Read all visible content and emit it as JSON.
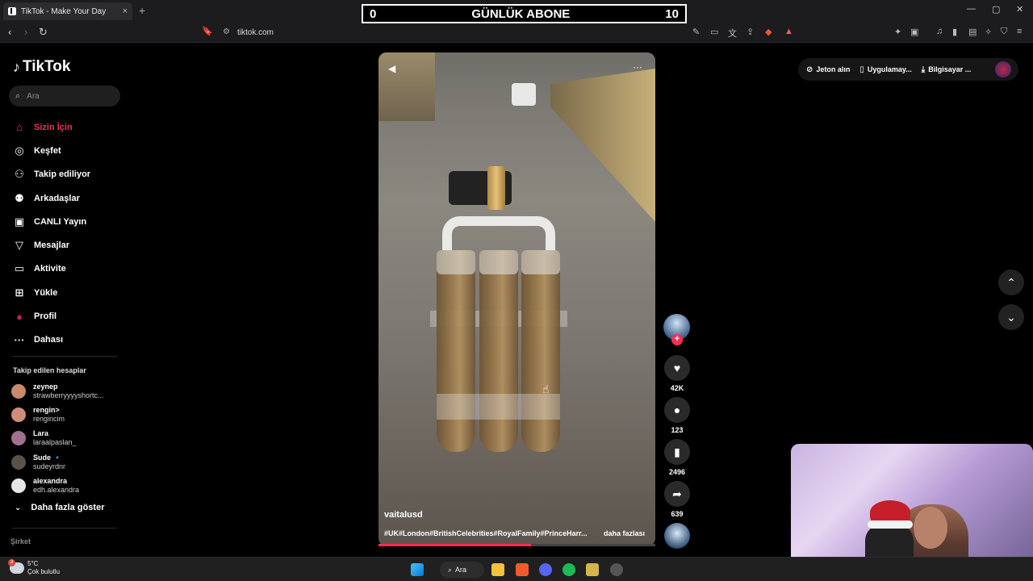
{
  "browser": {
    "tab_title": "TikTok - Make Your Day",
    "tab_close": "×",
    "new_tab": "+",
    "url": "tiktok.com",
    "window_controls": [
      "—",
      "▢",
      "✕"
    ]
  },
  "overlay": {
    "left_score": "0",
    "title": "GÜNLÜK ABONE",
    "right_score": "10"
  },
  "sidebar": {
    "logo": "TikTok",
    "search_placeholder": "Ara",
    "menu": [
      {
        "label": "Sizin İçin",
        "icon": "home-icon",
        "active": true
      },
      {
        "label": "Keşfet",
        "icon": "compass-icon",
        "active": false
      },
      {
        "label": "Takip ediliyor",
        "icon": "following-icon",
        "active": false
      },
      {
        "label": "Arkadaşlar",
        "icon": "friends-icon",
        "active": false
      },
      {
        "label": "CANLI Yayın",
        "icon": "live-icon",
        "active": false
      },
      {
        "label": "Mesajlar",
        "icon": "messages-icon",
        "active": false
      },
      {
        "label": "Aktivite",
        "icon": "activity-icon",
        "active": false
      },
      {
        "label": "Yükle",
        "icon": "upload-icon",
        "active": false
      },
      {
        "label": "Profil",
        "icon": "profile-icon",
        "active": false
      },
      {
        "label": "Dahası",
        "icon": "more-icon",
        "active": false
      }
    ],
    "followed_title": "Takip edilen hesaplar",
    "followed": [
      {
        "name": "zeynep",
        "handle": "strawberryyyyshortc...",
        "color": "#c98a6e"
      },
      {
        "name": "rengin>",
        "handle": "rengincim",
        "color": "#d08c7a"
      },
      {
        "name": "Lara",
        "handle": "laraalpaslan_",
        "color": "#a07090"
      },
      {
        "name": "Sude 🔹",
        "handle": "sudeyrdnr",
        "color": "#5a5248"
      },
      {
        "name": "alexandra",
        "handle": "edh.alexandra",
        "color": "#e6e6e6"
      }
    ],
    "show_more": "Daha fazla göster",
    "company": "Şirket"
  },
  "video": {
    "author": "vaitalusd",
    "tags": "#UK#London#BritishCelebrities#RoyalFamily#PrinceHarr...",
    "more": "daha fazlası",
    "progress": 0.55
  },
  "actions": {
    "likes": "42K",
    "comments": "123",
    "saves": "2496",
    "shares": "639"
  },
  "top_nav": {
    "coins": "Jeton alın",
    "app": "Uygulamay...",
    "pc": "Bilgisayar ..."
  },
  "taskbar": {
    "temp": "5°C",
    "weather": "Çok bulutlu",
    "search": "Ara",
    "weather_badge": "3"
  }
}
